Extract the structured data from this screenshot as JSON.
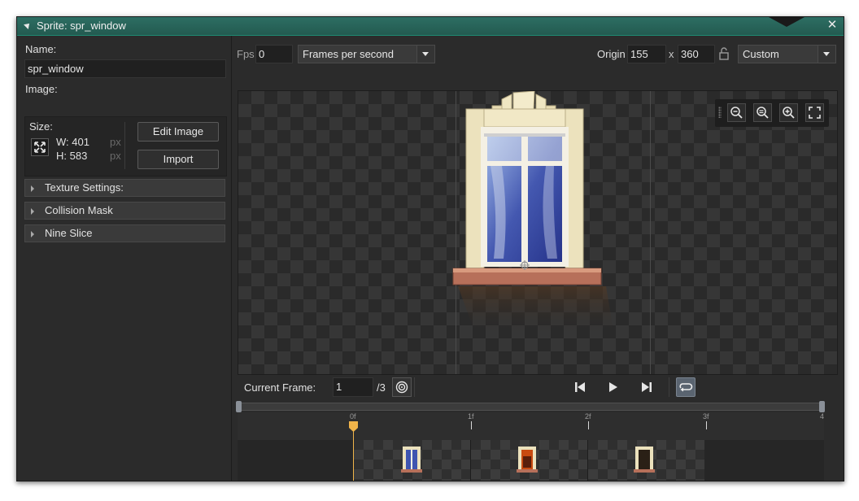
{
  "window": {
    "title": "Sprite: spr_window"
  },
  "left": {
    "name_label": "Name:",
    "name_value": "spr_window",
    "image_label": "Image:",
    "size_label": "Size:",
    "width_text": "W: 401",
    "height_text": "H: 583",
    "px1": "px",
    "px2": "px",
    "edit_image": "Edit Image",
    "import": "Import",
    "sections": [
      "Texture Settings:",
      "Collision Mask",
      "Nine Slice"
    ]
  },
  "top": {
    "fps_label": "Fps",
    "fps_value": "0",
    "fps_mode": "Frames per second",
    "origin_label": "Origin",
    "origin_x": "155",
    "origin_sep": "x",
    "origin_y": "360",
    "origin_mode": "Custom"
  },
  "playback": {
    "current_frame_label": "Current Frame:",
    "current_frame_value": "1",
    "frame_total": "/3"
  },
  "timeline": {
    "ticks": [
      "0f",
      "1f",
      "2f",
      "3f",
      "4"
    ]
  },
  "colors": {
    "accent": "#2d6e63",
    "playhead": "#f0b44a",
    "loop_active": "#5a6470"
  },
  "icons": {
    "toolbar": [
      "zoom-out-icon",
      "zoom-reset-icon",
      "zoom-in-icon",
      "fullscreen-icon"
    ],
    "playback": [
      "onion-skin-icon",
      "first-frame-icon",
      "play-icon",
      "last-frame-icon",
      "loop-icon"
    ]
  }
}
